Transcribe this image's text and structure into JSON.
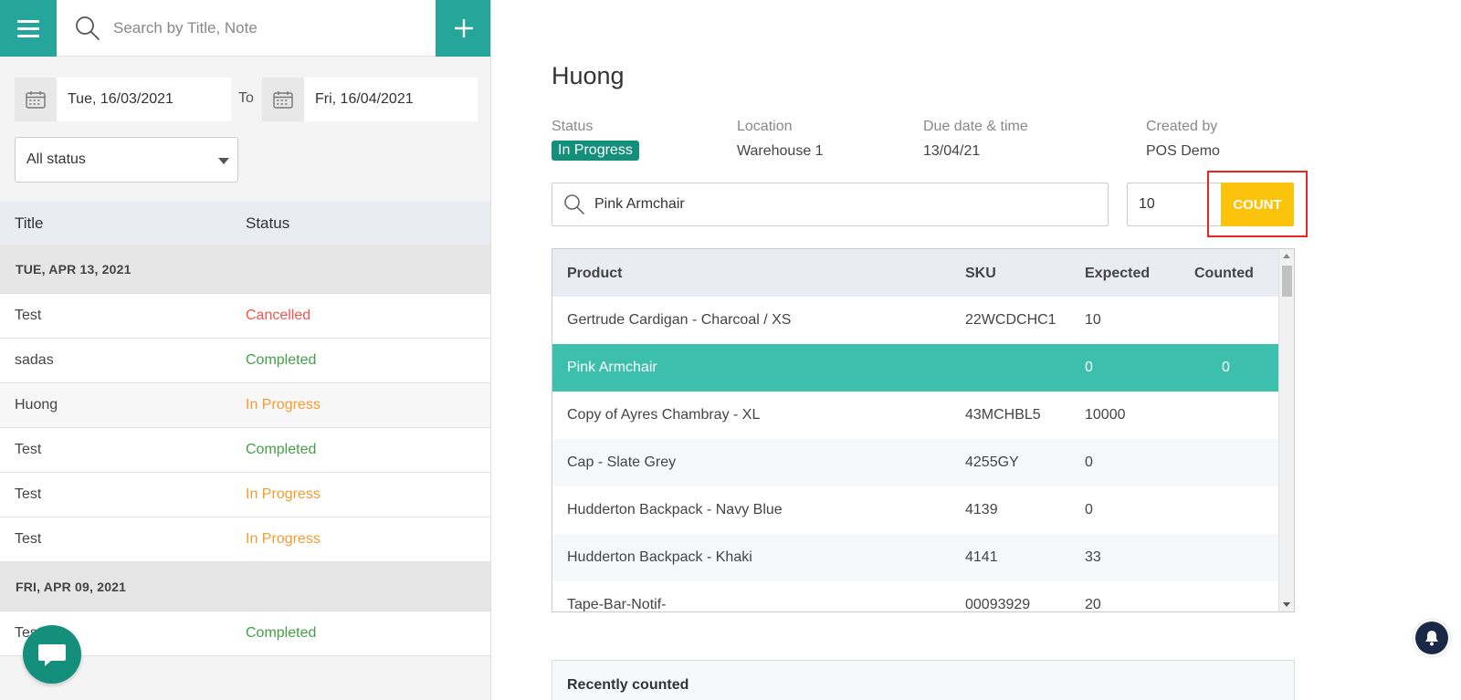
{
  "sidebar": {
    "search_placeholder": "Search by Title, Note",
    "date_from": "Tue, 16/03/2021",
    "to_label": "To",
    "date_to": "Fri, 16/04/2021",
    "status_filter": "All status",
    "columns": {
      "title": "Title",
      "status": "Status"
    },
    "groups": [
      {
        "date": "TUE, APR 13, 2021",
        "items": [
          {
            "title": "Test",
            "status": "Cancelled"
          },
          {
            "title": "sadas",
            "status": "Completed"
          },
          {
            "title": "Huong",
            "status": "In Progress"
          },
          {
            "title": "Test",
            "status": "Completed"
          },
          {
            "title": "Test",
            "status": "In Progress"
          },
          {
            "title": "Test",
            "status": "In Progress"
          }
        ]
      },
      {
        "date": "FRI, APR 09, 2021",
        "items": [
          {
            "title": "Test",
            "status": "Completed"
          }
        ]
      }
    ]
  },
  "detail": {
    "title": "Huong",
    "status_label": "Status",
    "status_value": "In Progress",
    "location_label": "Location",
    "location_value": "Warehouse 1",
    "due_label": "Due date & time",
    "due_value": "13/04/21",
    "created_label": "Created by",
    "created_value": "POS Demo",
    "product_search_value": "Pink Armchair",
    "quantity_value": "10",
    "count_button": "COUNT",
    "table": {
      "headers": {
        "product": "Product",
        "sku": "SKU",
        "expected": "Expected",
        "counted": "Counted"
      },
      "rows": [
        {
          "product": "Gertrude Cardigan - Charcoal / XS",
          "sku": "22WCDCHC1",
          "expected": "10",
          "counted": ""
        },
        {
          "product": "Pink Armchair",
          "sku": "",
          "expected": "0",
          "counted": "0"
        },
        {
          "product": "Copy of Ayres Chambray - XL",
          "sku": "43MCHBL5",
          "expected": "10000",
          "counted": ""
        },
        {
          "product": "Cap - Slate Grey",
          "sku": "4255GY",
          "expected": "0",
          "counted": ""
        },
        {
          "product": "Hudderton Backpack - Navy Blue",
          "sku": "4139",
          "expected": "0",
          "counted": ""
        },
        {
          "product": "Hudderton Backpack - Khaki",
          "sku": "4141",
          "expected": "33",
          "counted": ""
        },
        {
          "product": "Tape-Bar-Notif-",
          "sku": "00093929",
          "expected": "20",
          "counted": ""
        }
      ]
    },
    "recently_counted_label": "Recently counted"
  },
  "colors": {
    "accent": "#26a69a",
    "selected_row": "#3dbfae",
    "count_button": "#fcc30c",
    "cancelled": "#f0574f",
    "completed": "#43a047",
    "in_progress": "#f39c32"
  }
}
